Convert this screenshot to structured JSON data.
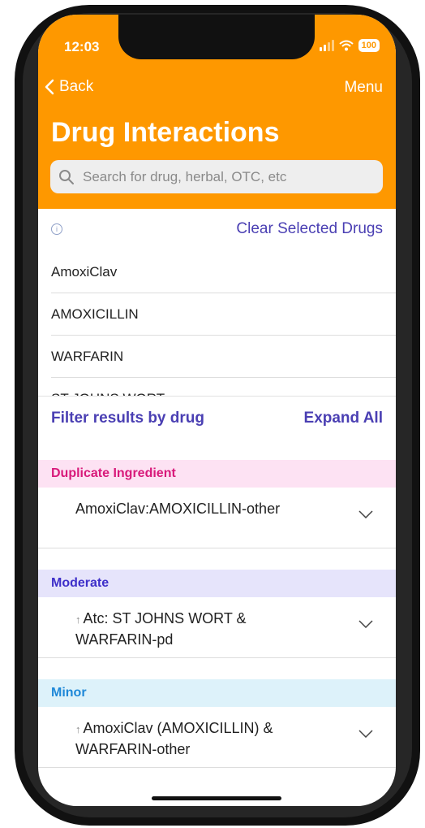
{
  "status_bar": {
    "time": "12:03",
    "battery": "100"
  },
  "nav": {
    "back_label": "Back",
    "menu_label": "Menu"
  },
  "page_title": "Drug Interactions",
  "search": {
    "placeholder": "Search for drug, herbal, OTC, etc"
  },
  "clear_label": "Clear Selected Drugs",
  "selected_drugs": [
    "AmoxiClav",
    "AMOXICILLIN",
    "WARFARIN",
    "ST JOHNS WORT"
  ],
  "filter": {
    "label": "Filter results by drug",
    "expand_label": "Expand All"
  },
  "colors": {
    "accent": "#fe9800",
    "link": "#4a3fb3"
  },
  "sections": [
    {
      "label": "Duplicate Ingredient",
      "bg": "#fde2f3",
      "fg": "#d8197a",
      "item": "AmoxiClav:AMOXICILLIN-other"
    },
    {
      "label": "Moderate",
      "bg": "#e6e4fb",
      "fg": "#3e2fc9",
      "item": "Atc: ST JOHNS WORT & WARFARIN-pd"
    },
    {
      "label": "Minor",
      "bg": "#ddf2fa",
      "fg": "#1e88d8",
      "item": "AmoxiClav (AMOXICILLIN) & WARFARIN-other"
    }
  ]
}
